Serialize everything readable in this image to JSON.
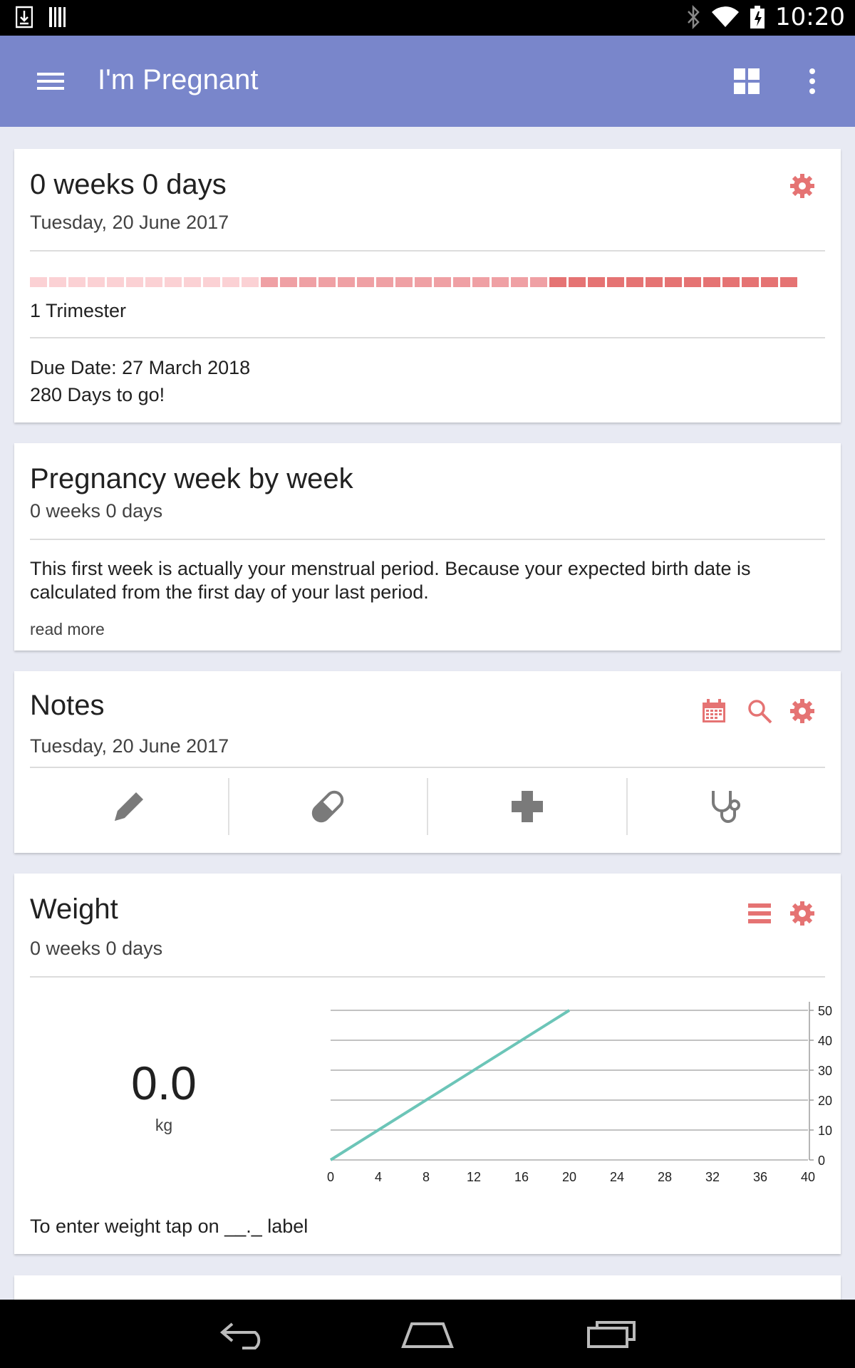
{
  "status_bar": {
    "time": "10:20",
    "icons": [
      "download-icon",
      "barcode-icon",
      "bluetooth-icon",
      "wifi-icon",
      "battery-icon"
    ]
  },
  "app_bar": {
    "title": "I'm Pregnant",
    "icons": [
      "menu-icon",
      "grid-view-icon",
      "more-vert-icon"
    ]
  },
  "colors": {
    "accent": "#e57373",
    "appbar": "#7986cb",
    "chart_line": "#6cc5b8"
  },
  "pregnancy_card": {
    "title": "0 weeks 0 days",
    "date": "Tuesday, 20 June 2017",
    "trimester_label": "1 Trimester",
    "due_date": "Due Date: 27 March 2018",
    "days_to_go": "280 Days to go!"
  },
  "week_card": {
    "title": "Pregnancy week by week",
    "subtitle": "0 weeks 0 days",
    "text": "This first week is actually your menstrual period. Because your expected birth date is calculated from the first day of your last period.",
    "read_more": "read more"
  },
  "notes_card": {
    "title": "Notes",
    "date": "Tuesday, 20 June 2017",
    "actions": [
      "pencil-icon",
      "pill-icon",
      "medical-cross-icon",
      "stethoscope-icon"
    ]
  },
  "weight_card": {
    "title": "Weight",
    "subtitle": "0 weeks 0 days",
    "value": "0.0",
    "unit": "kg",
    "hint": "To enter weight tap on __._ label"
  },
  "chart_data": {
    "type": "line",
    "x_ticks": [
      "0",
      "4",
      "8",
      "12",
      "16",
      "20",
      "24",
      "28",
      "32",
      "36",
      "40"
    ],
    "y_ticks": [
      "0",
      "10",
      "20",
      "30",
      "40",
      "50"
    ],
    "xlim": [
      0,
      40
    ],
    "ylim": [
      0,
      50
    ],
    "series": [
      {
        "x": [
          0,
          20
        ],
        "y": [
          0,
          50
        ]
      }
    ],
    "grid": true,
    "y_axis_side": "right"
  }
}
